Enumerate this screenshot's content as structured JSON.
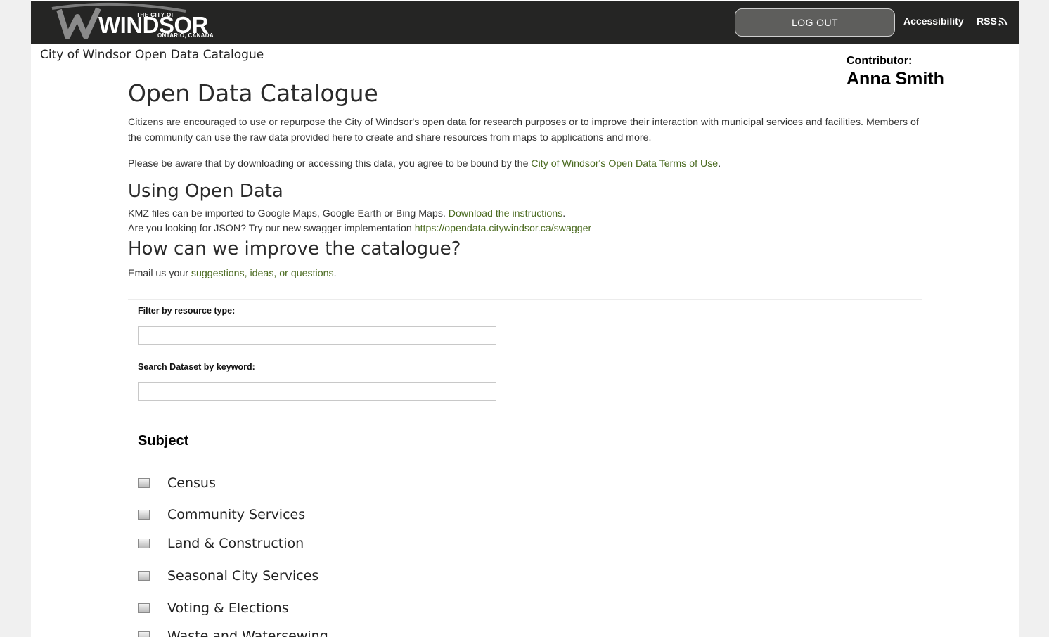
{
  "header": {
    "logo": {
      "small_text": "THE CITY OF",
      "main_text": "WINDSOR",
      "sub_text": "ONTARIO, CANADA"
    },
    "logout_label": "LOG OUT",
    "accessibility_label": "Accessibility",
    "rss_label": "RSS",
    "rss_icon": "rss-feed-icon"
  },
  "site_title": "City of Windsor Open Data Catalogue",
  "contributor": {
    "label": "Contributor:",
    "name": "Anna Smith"
  },
  "main": {
    "title": "Open Data Catalogue",
    "intro": "Citizens are encouraged to use or repurpose the City of Windsor's open data for research purposes or to improve their interaction with municipal services and facilities. Members of the community can use the raw data provided here to create and share resources from maps to applications and more.",
    "terms_prefix": "Please be aware that by downloading or accessing this data, you agree to be bound by the ",
    "terms_link": "City of Windsor's Open Data Terms of Use",
    "terms_suffix": ".",
    "using_heading": "Using Open Data",
    "kmz_text": "KMZ files can be imported to Google Maps, Google Earth or Bing Maps. ",
    "kmz_link": "Download the instructions",
    "kmz_suffix": ".",
    "json_text": "Are you looking for JSON? Try our new swagger implementation ",
    "json_link": "https://opendata.citywindsor.ca/swagger",
    "improve_heading": "How can we improve the catalogue?",
    "email_prefix": "Email us your ",
    "email_link": "suggestions, ideas, or questions",
    "email_suffix": "."
  },
  "filters": {
    "resource_type_label": "Filter by resource type:",
    "resource_type_value": "",
    "keyword_label": "Search Dataset by keyword:",
    "keyword_value": ""
  },
  "subject": {
    "title": "Subject",
    "items": [
      {
        "label": "Census",
        "checked": false
      },
      {
        "label": "Community Services",
        "checked": false
      },
      {
        "label": "Land & Construction",
        "checked": false
      },
      {
        "label": "Seasonal City Services",
        "checked": false
      },
      {
        "label": "Voting & Elections",
        "checked": false
      },
      {
        "label": "Waste and Watersewing",
        "checked": false
      }
    ]
  },
  "colors": {
    "header_bg": "#252524",
    "link_green": "#4a6a1f",
    "logout_bg": "#5e5e5c"
  }
}
